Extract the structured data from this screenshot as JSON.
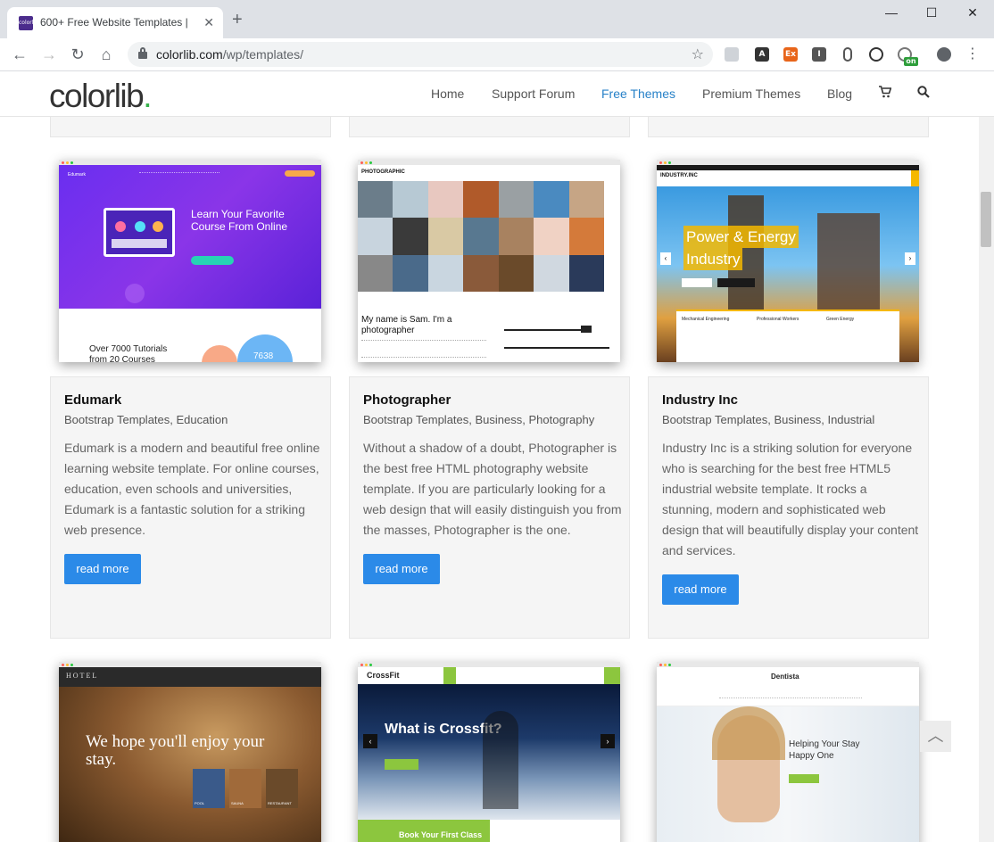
{
  "browser": {
    "tab_title": "600+ Free Website Templates |",
    "favicon_text": "colorlib",
    "url_domain": "colorlib.com",
    "url_path": "/wp/templates/",
    "ext_on_badge": "on"
  },
  "site": {
    "logo": "colorlib",
    "logo_dot": ".",
    "nav": [
      "Home",
      "Support Forum",
      "Free Themes",
      "Premium Themes",
      "Blog"
    ],
    "active_nav": "Free Themes",
    "accent_color": "#2882c8",
    "button_color": "#2b8ae8"
  },
  "cards": [
    {
      "title": "Edumark",
      "categories": "Bootstrap Templates, Education",
      "description": "Edumark is a modern and beautiful free online learning website template. For online courses, education, even schools and universities, Edumark is a fantastic solution for a striking web presence.",
      "button": "read more",
      "preview": {
        "logo": "Edumark",
        "headline": "Learn Your Favorite Course From Online",
        "subtext": "Over 7000 Tutorials from 20 Courses",
        "badge": "7638"
      }
    },
    {
      "title": "Photographer",
      "categories": "Bootstrap Templates, Business, Photography",
      "description": "Without a shadow of a doubt, Photographer is the best free HTML photography website template. If you are particularly looking for a web design that will easily distinguish you from the masses, Photographer is the one.",
      "button": "read more",
      "preview": {
        "logo": "PHOTOGRAPHIC",
        "headline": "My name is Sam. I'm a photographer"
      }
    },
    {
      "title": "Industry Inc",
      "categories": "Bootstrap Templates, Business, Industrial",
      "description": "Industry Inc is a striking solution for everyone who is searching for the best free HTML5 industrial website template. It rocks a stunning, modern and sophisticated web design that will beautifully display your content and services.",
      "button": "read more",
      "preview": {
        "logo": "INDUSTRY.INC",
        "headline_line1": "Power & Energy",
        "headline_line2": "Industry",
        "features": [
          "Mechanical Engineering",
          "Professional Workers",
          "Green Energy"
        ]
      }
    }
  ],
  "row2_previews": [
    {
      "logo": "HOTEL",
      "headline": "We hope you'll enjoy your stay.",
      "tiles": [
        "POOL",
        "SAUNA",
        "RESTAURANT"
      ]
    },
    {
      "logo": "CrossFit",
      "headline": "What is Crossfit?",
      "cta": "Book Your First Class"
    },
    {
      "logo": "Dentista",
      "headline": "Helping Your Stay Happy One"
    }
  ],
  "back_to_top_icon": "chevron-up-icon"
}
